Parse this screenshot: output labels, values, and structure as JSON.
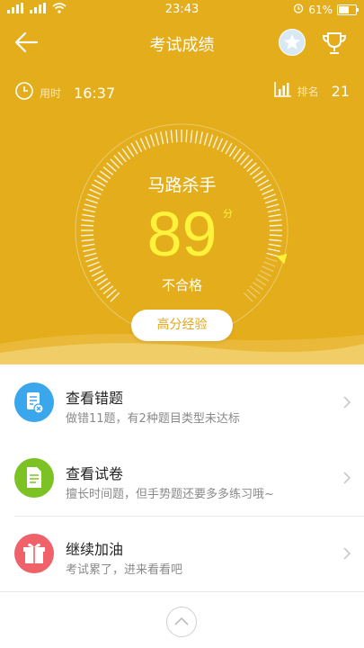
{
  "status_bar": {
    "signal_left": "⁴⁶",
    "signal_right": "⁴⁶",
    "time": "23:43",
    "battery": "61%",
    "battery_level": 0.61
  },
  "nav": {
    "title": "考试成绩",
    "back_icon": "arrow-left-icon",
    "badge_icon": "star-badge-icon",
    "trophy_icon": "trophy-icon"
  },
  "stats": {
    "time_label": "用时",
    "time_value": "16:37",
    "rank_label": "排名",
    "rank_value": "21"
  },
  "score": {
    "title": "马路杀手",
    "value": "89",
    "unit": "分",
    "status": "不合格",
    "level": 0.89
  },
  "actions": {
    "experience_button": "高分经验"
  },
  "list": [
    {
      "title": "查看错题",
      "subtitle": "做错11题，有2种题目类型未达标",
      "icon": "wrong-answer-icon",
      "color": "#3aa6ec"
    },
    {
      "title": "查看试卷",
      "subtitle": "擅长时间题，但手势题还要多多练习哦~",
      "icon": "exam-paper-icon",
      "color": "#7dc225"
    },
    {
      "title": "继续加油",
      "subtitle": "考试累了，进来看看吧",
      "icon": "gift-icon",
      "color": "#f0626a"
    }
  ],
  "colors": {
    "header": "#e3ad1c",
    "score": "#fff23b",
    "button_text": "#e3a61b"
  }
}
